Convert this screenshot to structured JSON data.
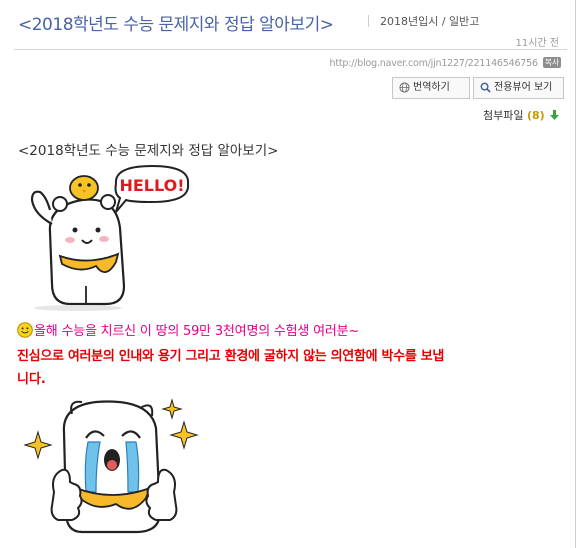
{
  "header": {
    "title": "<2018학년도 수능 문제지와 정답 알아보기>",
    "category": "2018년입시 / 일반고",
    "time": "11시간 전"
  },
  "meta": {
    "url": "http://blog.naver.com/jjn1227/221146546756",
    "copy_badge": "복사",
    "translate_label": "번역하기",
    "viewer_label": "전용뷰어 보기",
    "attach_label": "첨부파일",
    "attach_count": "(8)"
  },
  "post": {
    "title": "<2018학년도 수능 문제지와 정답 알아보기>",
    "sticker1_text": "HELLO!",
    "line1": "올해 수능을 치르신 이 땅의 59만 3천여명의 수험생 여러분~",
    "line2": "진심으로 여러분의 인내와 용기 그리고 환경에 굴하지 않는 의연함에 박수를 보냅",
    "line3": "니다."
  }
}
